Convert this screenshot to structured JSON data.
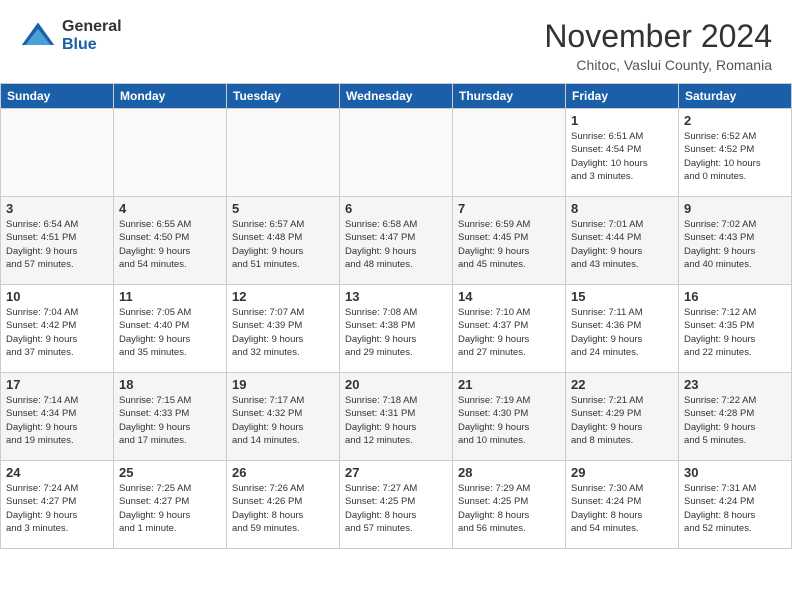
{
  "logo": {
    "general": "General",
    "blue": "Blue"
  },
  "title": "November 2024",
  "location": "Chitoc, Vaslui County, Romania",
  "weekdays": [
    "Sunday",
    "Monday",
    "Tuesday",
    "Wednesday",
    "Thursday",
    "Friday",
    "Saturday"
  ],
  "weeks": [
    [
      {
        "day": "",
        "info": ""
      },
      {
        "day": "",
        "info": ""
      },
      {
        "day": "",
        "info": ""
      },
      {
        "day": "",
        "info": ""
      },
      {
        "day": "",
        "info": ""
      },
      {
        "day": "1",
        "info": "Sunrise: 6:51 AM\nSunset: 4:54 PM\nDaylight: 10 hours\nand 3 minutes."
      },
      {
        "day": "2",
        "info": "Sunrise: 6:52 AM\nSunset: 4:52 PM\nDaylight: 10 hours\nand 0 minutes."
      }
    ],
    [
      {
        "day": "3",
        "info": "Sunrise: 6:54 AM\nSunset: 4:51 PM\nDaylight: 9 hours\nand 57 minutes."
      },
      {
        "day": "4",
        "info": "Sunrise: 6:55 AM\nSunset: 4:50 PM\nDaylight: 9 hours\nand 54 minutes."
      },
      {
        "day": "5",
        "info": "Sunrise: 6:57 AM\nSunset: 4:48 PM\nDaylight: 9 hours\nand 51 minutes."
      },
      {
        "day": "6",
        "info": "Sunrise: 6:58 AM\nSunset: 4:47 PM\nDaylight: 9 hours\nand 48 minutes."
      },
      {
        "day": "7",
        "info": "Sunrise: 6:59 AM\nSunset: 4:45 PM\nDaylight: 9 hours\nand 45 minutes."
      },
      {
        "day": "8",
        "info": "Sunrise: 7:01 AM\nSunset: 4:44 PM\nDaylight: 9 hours\nand 43 minutes."
      },
      {
        "day": "9",
        "info": "Sunrise: 7:02 AM\nSunset: 4:43 PM\nDaylight: 9 hours\nand 40 minutes."
      }
    ],
    [
      {
        "day": "10",
        "info": "Sunrise: 7:04 AM\nSunset: 4:42 PM\nDaylight: 9 hours\nand 37 minutes."
      },
      {
        "day": "11",
        "info": "Sunrise: 7:05 AM\nSunset: 4:40 PM\nDaylight: 9 hours\nand 35 minutes."
      },
      {
        "day": "12",
        "info": "Sunrise: 7:07 AM\nSunset: 4:39 PM\nDaylight: 9 hours\nand 32 minutes."
      },
      {
        "day": "13",
        "info": "Sunrise: 7:08 AM\nSunset: 4:38 PM\nDaylight: 9 hours\nand 29 minutes."
      },
      {
        "day": "14",
        "info": "Sunrise: 7:10 AM\nSunset: 4:37 PM\nDaylight: 9 hours\nand 27 minutes."
      },
      {
        "day": "15",
        "info": "Sunrise: 7:11 AM\nSunset: 4:36 PM\nDaylight: 9 hours\nand 24 minutes."
      },
      {
        "day": "16",
        "info": "Sunrise: 7:12 AM\nSunset: 4:35 PM\nDaylight: 9 hours\nand 22 minutes."
      }
    ],
    [
      {
        "day": "17",
        "info": "Sunrise: 7:14 AM\nSunset: 4:34 PM\nDaylight: 9 hours\nand 19 minutes."
      },
      {
        "day": "18",
        "info": "Sunrise: 7:15 AM\nSunset: 4:33 PM\nDaylight: 9 hours\nand 17 minutes."
      },
      {
        "day": "19",
        "info": "Sunrise: 7:17 AM\nSunset: 4:32 PM\nDaylight: 9 hours\nand 14 minutes."
      },
      {
        "day": "20",
        "info": "Sunrise: 7:18 AM\nSunset: 4:31 PM\nDaylight: 9 hours\nand 12 minutes."
      },
      {
        "day": "21",
        "info": "Sunrise: 7:19 AM\nSunset: 4:30 PM\nDaylight: 9 hours\nand 10 minutes."
      },
      {
        "day": "22",
        "info": "Sunrise: 7:21 AM\nSunset: 4:29 PM\nDaylight: 9 hours\nand 8 minutes."
      },
      {
        "day": "23",
        "info": "Sunrise: 7:22 AM\nSunset: 4:28 PM\nDaylight: 9 hours\nand 5 minutes."
      }
    ],
    [
      {
        "day": "24",
        "info": "Sunrise: 7:24 AM\nSunset: 4:27 PM\nDaylight: 9 hours\nand 3 minutes."
      },
      {
        "day": "25",
        "info": "Sunrise: 7:25 AM\nSunset: 4:27 PM\nDaylight: 9 hours\nand 1 minute."
      },
      {
        "day": "26",
        "info": "Sunrise: 7:26 AM\nSunset: 4:26 PM\nDaylight: 8 hours\nand 59 minutes."
      },
      {
        "day": "27",
        "info": "Sunrise: 7:27 AM\nSunset: 4:25 PM\nDaylight: 8 hours\nand 57 minutes."
      },
      {
        "day": "28",
        "info": "Sunrise: 7:29 AM\nSunset: 4:25 PM\nDaylight: 8 hours\nand 56 minutes."
      },
      {
        "day": "29",
        "info": "Sunrise: 7:30 AM\nSunset: 4:24 PM\nDaylight: 8 hours\nand 54 minutes."
      },
      {
        "day": "30",
        "info": "Sunrise: 7:31 AM\nSunset: 4:24 PM\nDaylight: 8 hours\nand 52 minutes."
      }
    ]
  ]
}
